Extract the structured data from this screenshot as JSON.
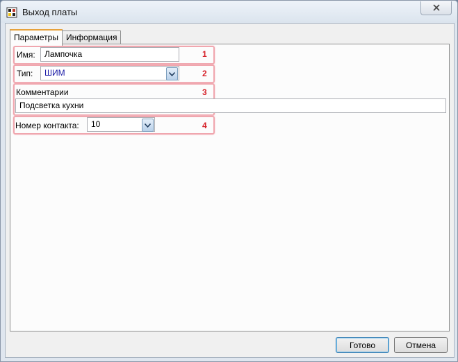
{
  "window": {
    "title": "Выход платы",
    "icons": {
      "app": "board-icon",
      "close": "close-icon"
    }
  },
  "tabs": [
    {
      "label": "Параметры",
      "active": true
    },
    {
      "label": "Информация",
      "active": false
    }
  ],
  "form": {
    "name_label": "Имя:",
    "name_value": "Лампочка",
    "type_label": "Тип:",
    "type_value": "ШИМ",
    "comment_label": "Комментарии",
    "comment_value": "Подсветка кухни",
    "contact_label": "Номер контакта:",
    "contact_value": "10"
  },
  "annotations": {
    "color": "#d6232b",
    "numbers": [
      "1",
      "2",
      "3",
      "4"
    ]
  },
  "buttons": {
    "ok_label": "Готово",
    "cancel_label": "Отмена"
  },
  "colors": {
    "accent_tab": "#e6a23c",
    "combo_text": "#1a1aa6"
  }
}
